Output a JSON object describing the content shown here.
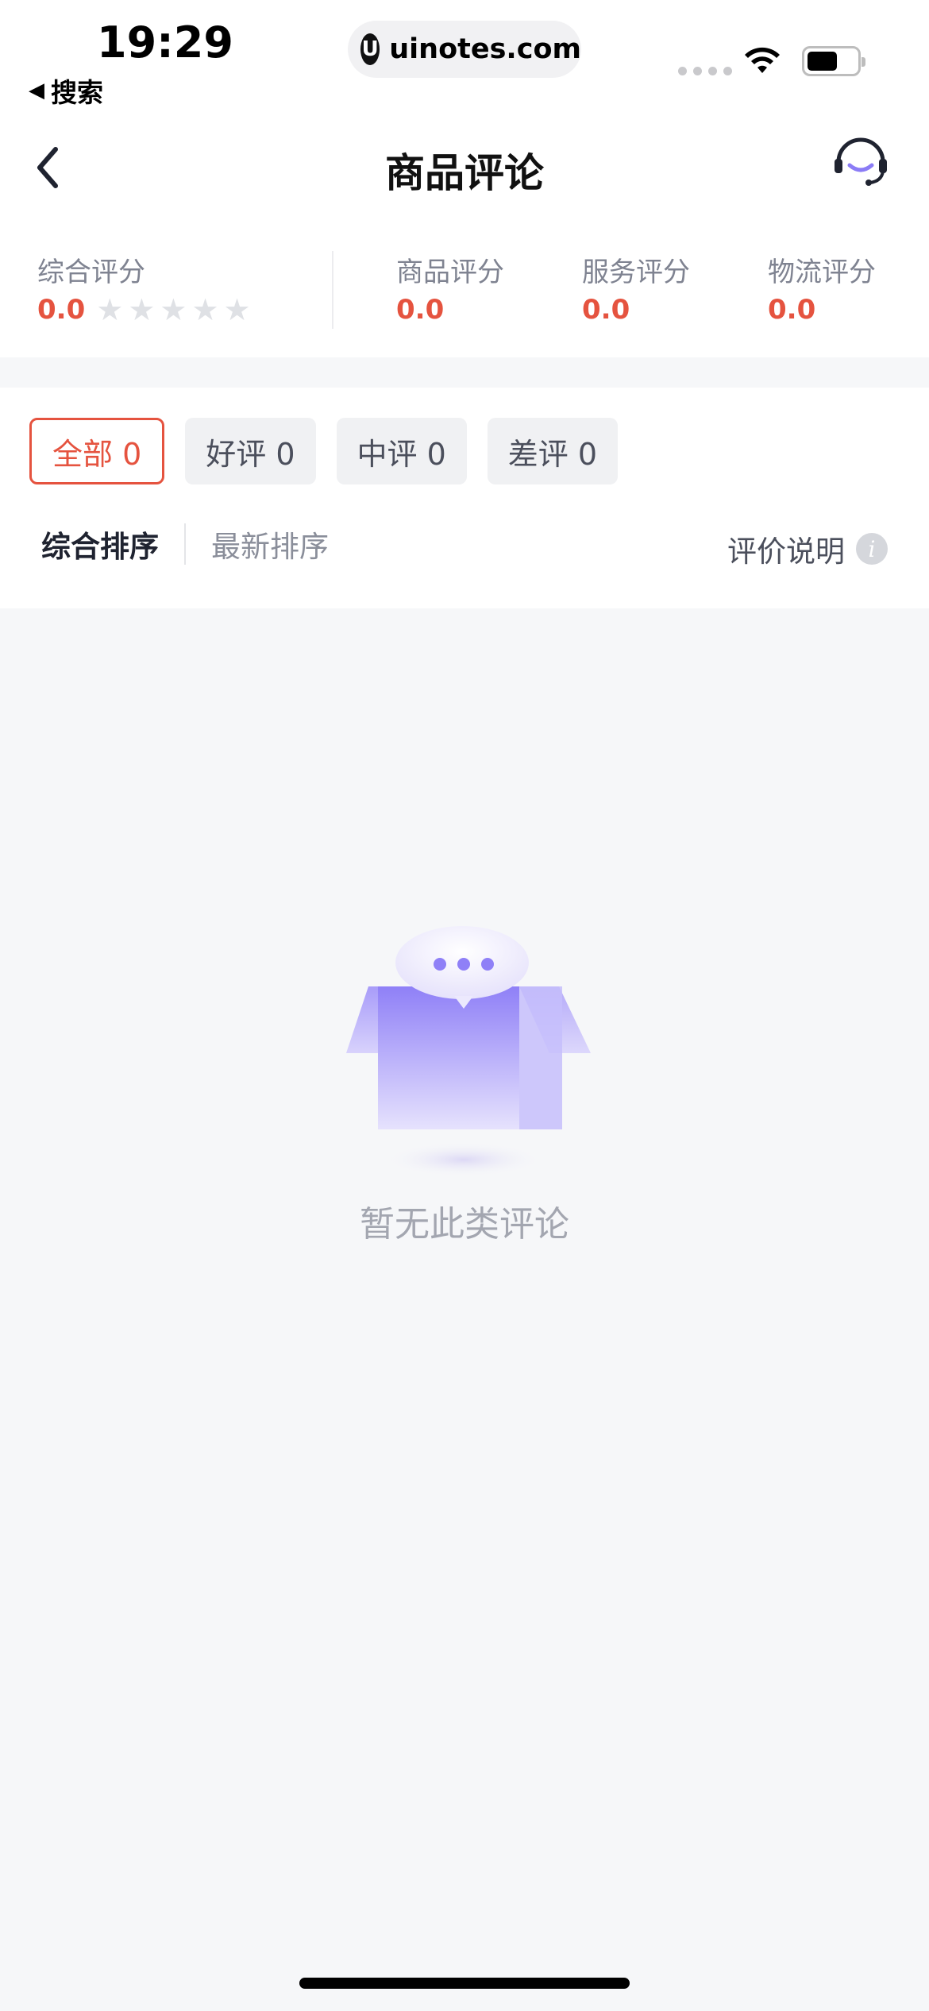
{
  "status_bar": {
    "time": "19:29",
    "back_app_label": "搜索",
    "url": "uinotes.com",
    "icons": [
      "signal-icon",
      "wifi-icon",
      "battery-icon"
    ]
  },
  "nav": {
    "title": "商品评论",
    "back_icon": "chevron-left-icon",
    "service_icon": "customer-service-icon"
  },
  "ratings": {
    "overall": {
      "label": "综合评分",
      "value": "0.0",
      "stars": 5
    },
    "product": {
      "label": "商品评分",
      "value": "0.0"
    },
    "service": {
      "label": "服务评分",
      "value": "0.0"
    },
    "logistics": {
      "label": "物流评分",
      "value": "0.0"
    }
  },
  "filters": [
    {
      "label": "全部 0",
      "active": true
    },
    {
      "label": "好评 0",
      "active": false
    },
    {
      "label": "中评 0",
      "active": false
    },
    {
      "label": "差评 0",
      "active": false
    }
  ],
  "sort": {
    "options": [
      {
        "label": "综合排序",
        "active": true
      },
      {
        "label": "最新排序",
        "active": false
      }
    ],
    "explain_label": "评价说明"
  },
  "empty_state": {
    "text": "暂无此类评论"
  },
  "colors": {
    "accent": "#e5533f",
    "illustration": "#8b7cf6",
    "page_bg": "#f6f7f9"
  }
}
